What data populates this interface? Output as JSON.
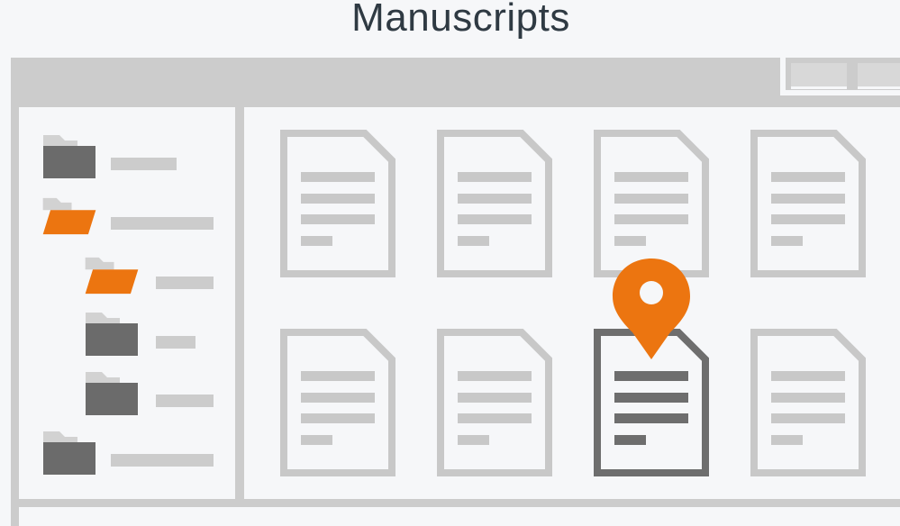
{
  "title": "Manuscripts",
  "colors": {
    "accent": "#ec7510",
    "folder_gray": "#6b6b6b",
    "chrome": "#cccccc",
    "doc_gray": "#c8c8c8",
    "doc_highlight": "#6e6e6e"
  },
  "sidebar": {
    "items": [
      {
        "icon": "folder-icon",
        "state": "closed",
        "level": 0
      },
      {
        "icon": "folder-open-icon",
        "state": "open",
        "level": 0
      },
      {
        "icon": "folder-open-icon",
        "state": "open",
        "level": 1
      },
      {
        "icon": "folder-icon",
        "state": "closed",
        "level": 1
      },
      {
        "icon": "folder-icon",
        "state": "closed",
        "level": 1
      },
      {
        "icon": "folder-icon",
        "state": "closed",
        "level": 0
      }
    ]
  },
  "main": {
    "documents": [
      {
        "icon": "document-icon",
        "highlighted": false
      },
      {
        "icon": "document-icon",
        "highlighted": false
      },
      {
        "icon": "document-icon",
        "highlighted": false
      },
      {
        "icon": "document-icon",
        "highlighted": false
      },
      {
        "icon": "document-icon",
        "highlighted": false
      },
      {
        "icon": "document-icon",
        "highlighted": false
      },
      {
        "icon": "document-icon",
        "highlighted": true
      },
      {
        "icon": "document-icon",
        "highlighted": false
      }
    ],
    "marker_icon": "location-pin-icon"
  }
}
